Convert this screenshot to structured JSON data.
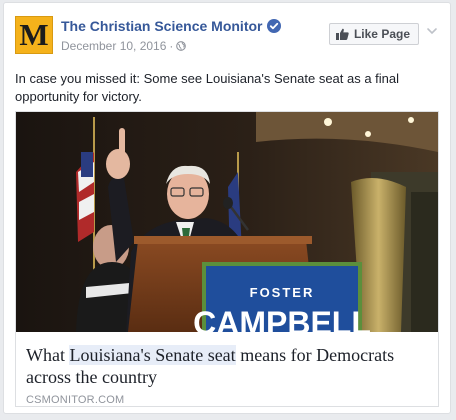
{
  "post": {
    "page_name": "The Christian Science Monitor",
    "logo_letter": "M",
    "date": "December 10, 2016",
    "separator": "·",
    "like_page_label": "Like Page",
    "message": "In case you missed it: Some see Louisiana's Senate seat as a final opportunity for victory.",
    "link": {
      "title_before": "What ",
      "title_highlight": "Louisiana's Senate seat",
      "title_after": " means for Democrats across the country",
      "domain": "CSMONITOR.COM",
      "sign_line1": "FOSTER",
      "sign_line2": "CAMPBELL"
    }
  },
  "colors": {
    "link_blue": "#365899",
    "logo_yellow": "#f5b21b",
    "verified_blue": "#4267b2",
    "sign_blue": "#1f4e9c"
  },
  "icons": [
    "verified-badge-icon",
    "globe-icon",
    "thumbs-up-icon",
    "chevron-down-icon"
  ]
}
